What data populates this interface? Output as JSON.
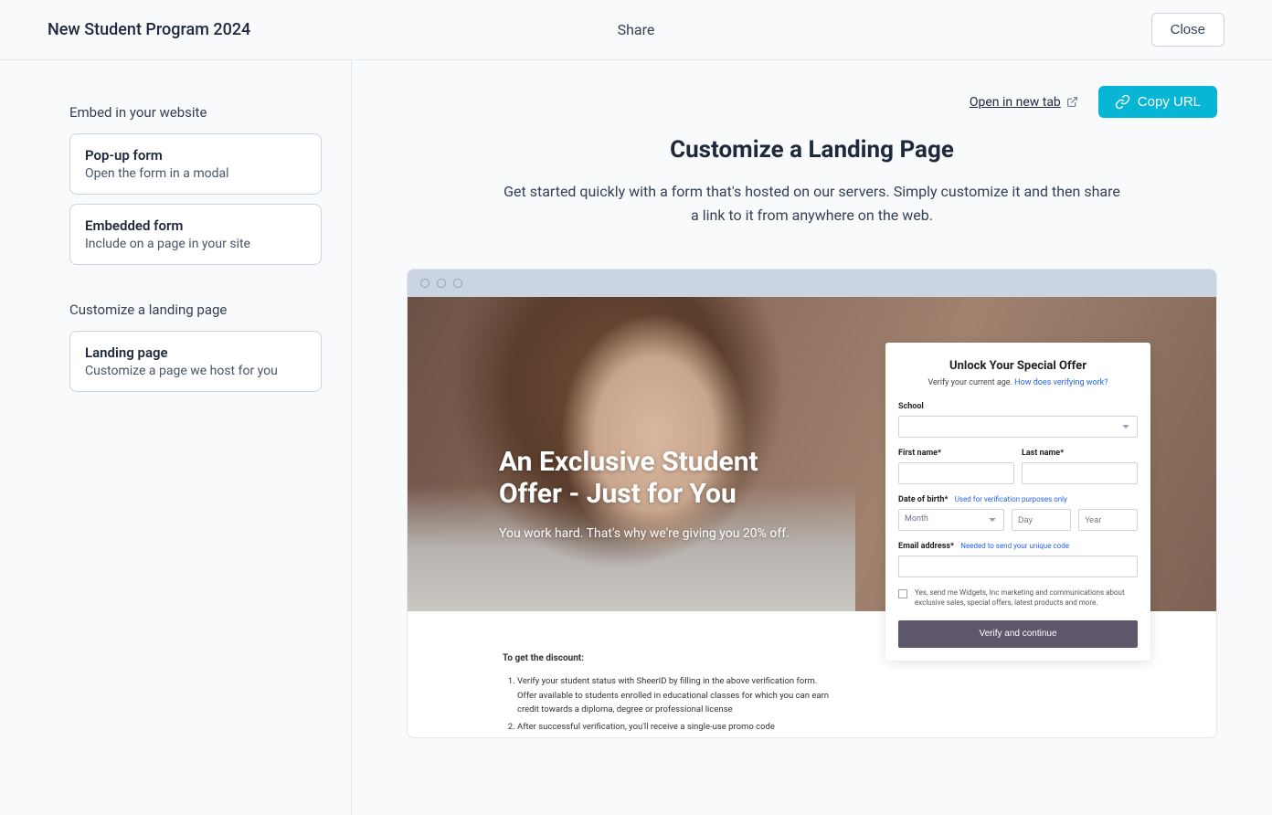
{
  "header": {
    "title": "New Student Program 2024",
    "center": "Share",
    "close": "Close"
  },
  "sidebar": {
    "section1_label": "Embed in your website",
    "items1": [
      {
        "title": "Pop-up form",
        "sub": "Open the form in a modal"
      },
      {
        "title": "Embedded form",
        "sub": "Include on a page in your site"
      }
    ],
    "section2_label": "Customize a landing page",
    "items2": [
      {
        "title": "Landing page",
        "sub": "Customize a page we host for you"
      }
    ]
  },
  "actions": {
    "open_new_tab": "Open in new tab",
    "copy_url": "Copy URL"
  },
  "content": {
    "heading": "Customize a Landing Page",
    "sub": "Get started quickly with a form that's hosted on our servers. Simply customize it and then share a link to it from anywhere on the web."
  },
  "preview": {
    "hero_title_1": "An Exclusive Student",
    "hero_title_2": "Offer - Just for You",
    "hero_sub": "You work hard. That's why we're giving you 20% off.",
    "form": {
      "title": "Unlock Your Special Offer",
      "sub_text": "Verify your current age. ",
      "sub_link": "How does verifying work?",
      "school_label": "School",
      "first_name_label": "First name*",
      "last_name_label": "Last name*",
      "dob_label": "Date of birth*",
      "dob_hint": "Used for verification purposes only",
      "month_placeholder": "Month",
      "day_placeholder": "Day",
      "year_placeholder": "Year",
      "email_label": "Email address*",
      "email_hint": "Needed to send your unique code",
      "checkbox_text": "Yes, send me Widgets, Inc marketing and communications about exclusive sales, special offers, latest products and more.",
      "verify_btn": "Verify and continue"
    },
    "discount": {
      "title": "To get the discount:",
      "step1": "Verify your student status with SheerID by filling in the above verification form. Offer available to students enrolled in educational classes for which you can earn credit towards a diploma, degree or professional license",
      "step2": "After successful verification, you'll receive a single-use promo code"
    }
  }
}
